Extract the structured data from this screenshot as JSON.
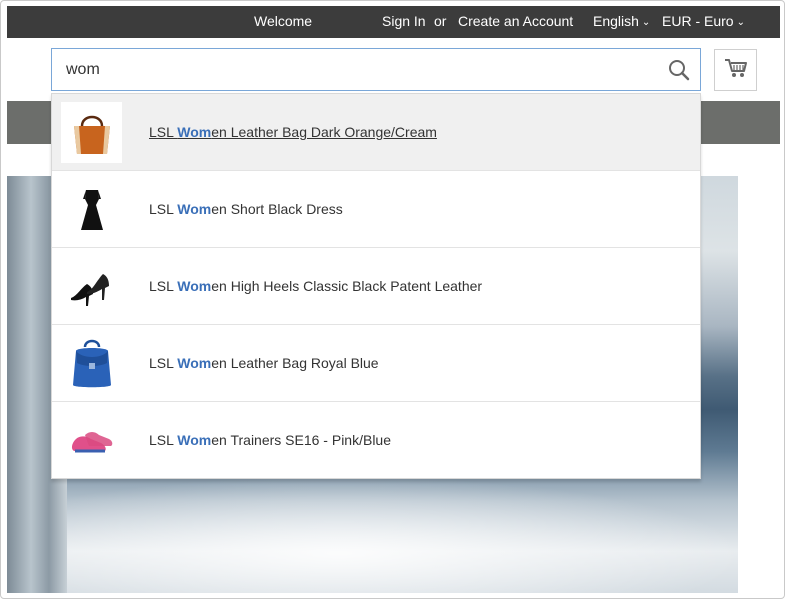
{
  "header": {
    "welcome": "Welcome",
    "sign_in": "Sign In",
    "or": "or",
    "create_account": "Create an Account",
    "language": "English",
    "currency": "EUR - Euro"
  },
  "search": {
    "value": "wom",
    "icon": "search-icon"
  },
  "cart": {
    "icon": "cart-icon"
  },
  "suggestions": [
    {
      "prefix": "LSL ",
      "match": "Wom",
      "rest": "en Leather Bag Dark Orange/Cream",
      "image": "orange-leather-bag",
      "selected": true
    },
    {
      "prefix": "LSL ",
      "match": "Wom",
      "rest": "en Short Black Dress",
      "image": "black-dress",
      "selected": false
    },
    {
      "prefix": "LSL ",
      "match": "Wom",
      "rest": "en High Heels Classic Black Patent Leather",
      "image": "black-heels",
      "selected": false
    },
    {
      "prefix": "LSL ",
      "match": "Wom",
      "rest": "en Leather Bag Royal Blue",
      "image": "blue-backpack",
      "selected": false
    },
    {
      "prefix": "LSL ",
      "match": "Wom",
      "rest": "en Trainers SE16 - Pink/Blue",
      "image": "pink-trainers",
      "selected": false
    }
  ],
  "colors": {
    "topbar": "#3c3c3c",
    "nav_band": "#6c6e6b",
    "highlight": "#3a6fb8",
    "search_border": "#7aa7d8"
  }
}
